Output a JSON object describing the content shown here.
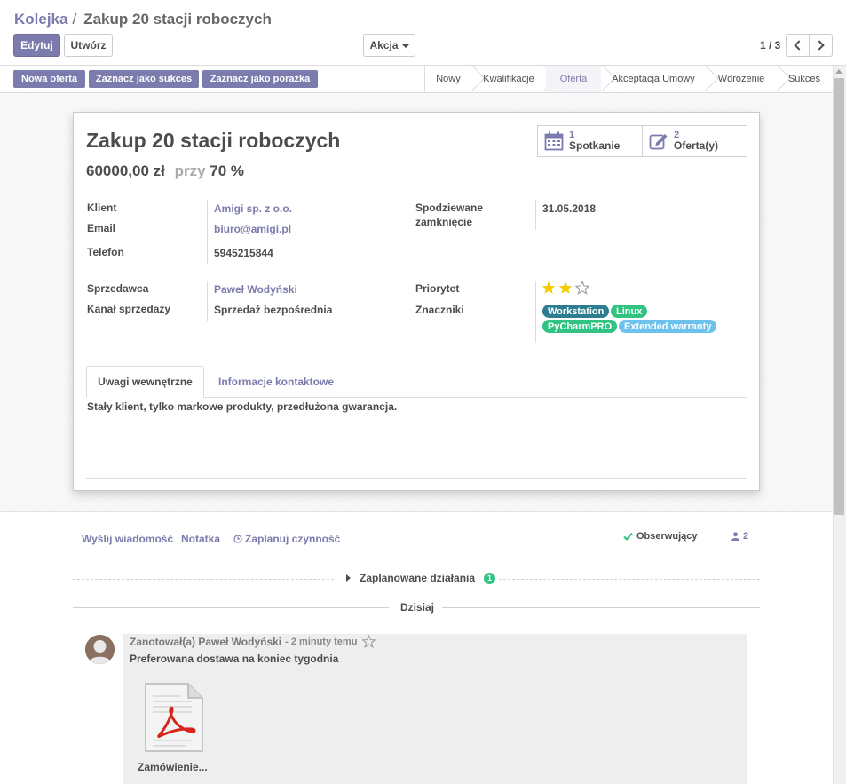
{
  "breadcrumb": {
    "parent": "Kolejka",
    "separator": "/",
    "current": "Zakup 20 stacji roboczych"
  },
  "buttons": {
    "edit": "Edytuj",
    "create": "Utwórz",
    "action": "Akcja"
  },
  "pager": {
    "value": "1 / 3"
  },
  "statusbar": {
    "actions": [
      "Nowa oferta",
      "Zaznacz jako sukces",
      "Zaznacz jako porażka"
    ],
    "stages": [
      "Nowy",
      "Kwalifikacje",
      "Oferta",
      "Akceptacja Umowy",
      "Wdrożenie",
      "Sukces"
    ],
    "active_stage": "Oferta"
  },
  "record": {
    "title": "Zakup 20 stacji roboczych",
    "revenue": "60000,00 zł",
    "at_word": "przy",
    "probability": "70 %",
    "smart_buttons": [
      {
        "count": "1",
        "label": "Spotkanie",
        "icon": "calendar-icon"
      },
      {
        "count": "2",
        "label": "Oferta(y)",
        "icon": "edit-icon"
      }
    ],
    "fields": {
      "customer_label": "Klient",
      "customer": "Amigi sp. z o.o.",
      "email_label": "Email",
      "email": "biuro@amigi.pl",
      "phone_label": "Telefon",
      "phone": "5945215844",
      "closing_label_1": "Spodziewane",
      "closing_label_2": "zamknięcie",
      "closing": "31.05.2018",
      "salesperson_label": "Sprzedawca",
      "salesperson": "Paweł Wodyński",
      "channel_label": "Kanał sprzedaży",
      "channel": "Sprzedaż bezpośrednia",
      "priority_label": "Priorytet",
      "priority_stars": 2,
      "priority_max": 3,
      "tags_label": "Znaczniki"
    },
    "tags": [
      {
        "name": "Workstation",
        "color": "#2c7e8f"
      },
      {
        "name": "Linux",
        "color": "#30c381"
      },
      {
        "name": "PyCharmPRO",
        "color": "#30c381"
      },
      {
        "name": "Extended warranty",
        "color": "#6cc1ed"
      }
    ],
    "tabs": [
      "Uwagi wewnętrzne",
      "Informacje kontaktowe"
    ],
    "note": "Stały klient, tylko markowe produkty, przedłużona gwarancja."
  },
  "chatter": {
    "send_message": "Wyślij wiadomość",
    "log_note": "Notatka",
    "schedule": "Zaplanuj czynność",
    "following": "Obserwujący",
    "followers_count": "2",
    "planned": "Zaplanowane działania",
    "planned_count": "1",
    "today": "Dzisiaj",
    "message": {
      "author": "Zanotował(a) Paweł Wodyński",
      "time": "- 2 minuty temu",
      "body": "Preferowana dostawa na koniec tygodnia",
      "attachment": "Zamówienie..."
    }
  },
  "colors": {
    "primary": "#7c7bad",
    "star": "#f3cc00",
    "badge_green": "#30c381"
  }
}
